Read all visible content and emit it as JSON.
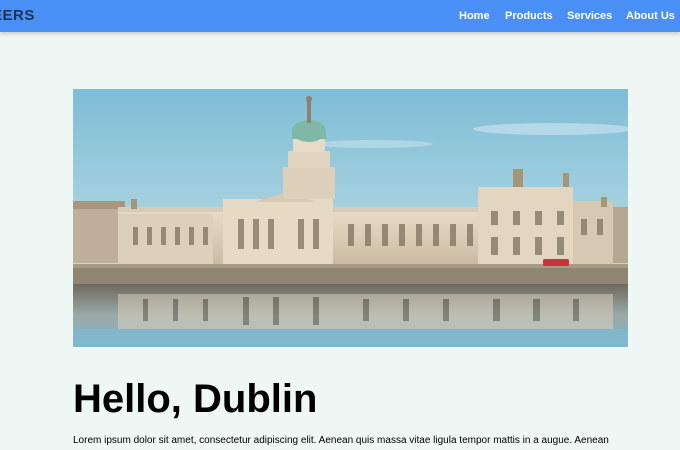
{
  "navbar": {
    "brand": "EERS",
    "links": [
      {
        "label": "Home"
      },
      {
        "label": "Products"
      },
      {
        "label": "Services"
      },
      {
        "label": "About Us"
      }
    ],
    "color": "#4a8ff5"
  },
  "hero_image": {
    "alt": "Custom House, Dublin"
  },
  "content": {
    "headline": "Hello, Dublin",
    "body": "Lorem ipsum dolor sit amet, consectetur adipiscing elit. Aenean quis massa vitae ligula tempor mattis in a augue. Aenean"
  },
  "colors": {
    "background": "#eff7f4",
    "nav": "#4a8ff5",
    "brand_text": "#1f3251"
  }
}
